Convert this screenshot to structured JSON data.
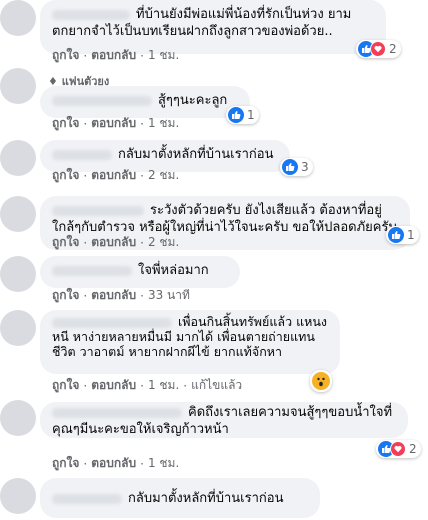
{
  "actions": {
    "like": "ถูกใจ",
    "reply": "ตอบกลับ",
    "edited": "แก้ไขแล้ว",
    "sep": "·"
  },
  "comments": [
    {
      "text": "ที่บ้านยังมีพ่อแม่พี่น้องที่รักเป็นห่วง ยามตกยากจำไว้เป็นบทเรียนฝากถึงลูกสาวของพ่อด้วย..",
      "time": "1 ชม.",
      "reactions": "2",
      "reaction_types": [
        "like",
        "love"
      ]
    },
    {
      "badge": "แฟนตัวยง",
      "text": "สู้ๆๆนะคะลูก",
      "time": "1 ชม.",
      "reactions": "1",
      "reaction_types": [
        "like"
      ]
    },
    {
      "text": "กลับมาตั้งหลักที่บ้านเราก่อน",
      "time": "2 ชม.",
      "reactions": "3",
      "reaction_types": [
        "like"
      ]
    },
    {
      "text": "ระวังตัวด้วยครับ ยังไงเสียแล้ว ต้องหาที่อยู่ใกล้ๆกับตำรวจ หรือผู้ใหญ่ที่น่าไว้ใจนะครับ ขอให้ปลอดภัยครับ",
      "time": "2 ชม.",
      "reactions": "1",
      "reaction_types": [
        "like"
      ]
    },
    {
      "text": "ใจพี่หล่อมาก",
      "time": "33 นาที"
    },
    {
      "text": "เพื่อนกินสิ้นทรัพย์แล้ว แหนงหนี หาง่ายหลายหมื่นมี มากได้ เพื่อนตายถ่ายแทนชีวิต วาอาตม์ หายากฝากผีไข้ ยากแท้จักหา",
      "time": "1 ชม.",
      "reactions": "",
      "reaction_types": [
        "wow"
      ]
    },
    {
      "text": "คิดถึงเราเลยความจนสู้ๆๆขอบน้ำใจที่คุณๆมีนะคะขอให้เจริญก้าวหน้า",
      "time": "1 ชม.",
      "reactions": "2",
      "reaction_types": [
        "like",
        "love"
      ]
    },
    {
      "text": "กลับมาตั้งหลักที่บ้านเราก่อน",
      "time": ""
    }
  ],
  "colors": {
    "accent": "#1877f2",
    "love": "#f33e58",
    "wow": "#f7b125",
    "bubble": "#f0f2f5",
    "meta": "#65676b"
  },
  "icons": {
    "like": "thumbs-up-icon",
    "love": "heart-icon",
    "wow": "wow-face-icon",
    "badge": "diamond-icon"
  }
}
